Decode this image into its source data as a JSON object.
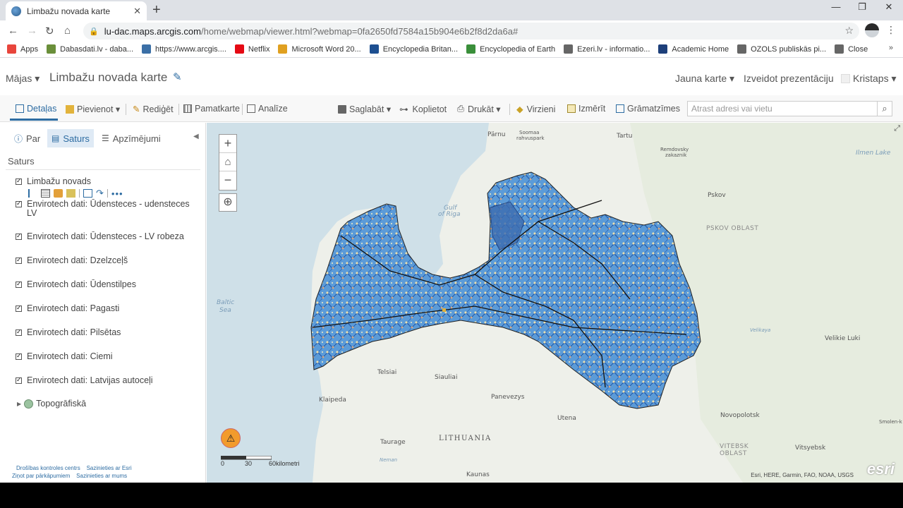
{
  "browser": {
    "tab_title": "Limbažu novada karte",
    "tab_close": "✕",
    "new_tab": "+",
    "win_min": "—",
    "win_max": "❐",
    "win_close": "✕",
    "url_host": "lu-dac.maps.arcgis.com",
    "url_path": "/home/webmap/viewer.html?webmap=0fa2650fd7584a15b904e6b2f8d2da6a#",
    "bookmarks": [
      {
        "label": "Apps",
        "color": "#e8453c"
      },
      {
        "label": "Dabasdati.lv - daba...",
        "color": "#6a8f3a"
      },
      {
        "label": "https://www.arcgis....",
        "color": "#3b6fa6"
      },
      {
        "label": "Netflix",
        "color": "#e50914"
      },
      {
        "label": "Microsoft Word 20...",
        "color": "#e0a020"
      },
      {
        "label": "Encyclopedia Britan...",
        "color": "#1d4f91"
      },
      {
        "label": "Encyclopedia of Earth",
        "color": "#3a8f3a"
      },
      {
        "label": "Ezeri.lv - informatio...",
        "color": "#666666"
      },
      {
        "label": "Academic Home",
        "color": "#1d3f7a"
      },
      {
        "label": "OZOLS publiskās pi...",
        "color": "#666666"
      },
      {
        "label": "Close",
        "color": "#666666"
      }
    ],
    "bookmarks_more": "»"
  },
  "header": {
    "home": "Mājas ▾",
    "title": "Limbažu novada karte",
    "new_map": "Jauna karte ▾",
    "create_presentation": "Izveidot prezentāciju",
    "user": "Kristaps ▾"
  },
  "toolbar": {
    "details": "Detaļas",
    "add": "Pievienot ▾",
    "edit": "Rediģēt",
    "basemap": "Pamatkarte",
    "analysis": "Analīze",
    "save": "Saglabāt ▾",
    "share": "Koplietot",
    "print": "Drukāt ▾",
    "directions": "Virzieni",
    "measure": "Izmērīt",
    "bookmarks": "Grāmatzīmes",
    "search_placeholder": "Atrast adresi vai vietu"
  },
  "panel": {
    "tab_about": "Par",
    "tab_content": "Saturs",
    "tab_legend": "Apzīmējumi",
    "heading": "Saturs",
    "layers": [
      "Limbažu novads",
      "Envirotech dati: Ūdensteces - udensteces LV",
      "Envirotech dati: Ūdensteces - LV robeza",
      "Envirotech dati: Dzelzceļš",
      "Envirotech dati: Ūdenstilpes",
      "Envirotech dati: Pagasti",
      "Envirotech dati: Pilsētas",
      "Envirotech dati: Ciemi",
      "Envirotech dati: Latvijas autoceļi"
    ],
    "basemap_layer": "Topogrāfiskā",
    "footer_1a": "Drošības kontroles centrs",
    "footer_1b": "Sazinieties ar Esri",
    "footer_2a": "Ziņot par pārkāpumiem",
    "footer_2b": "Sazinieties ar mums"
  },
  "map": {
    "scale_0": "0",
    "scale_30": "30",
    "scale_60": "60kilometri",
    "attribution": "Esri, HERE, Garmin, FAO, NOAA, USGS",
    "esri": "esri",
    "labels": {
      "parnu": "Pärnu",
      "soomaa": "Soomaa",
      "soomaa2": "rahvuspark",
      "tartu": "Tartu",
      "remdovsky": "Remdovsky",
      "zakaznik": "zakaznik",
      "ilmen": "Ilmen Lake",
      "pskov": "Pskov",
      "pskov_oblast": "PSKOV OBLAST",
      "gulf1": "Gulf",
      "gulf2": "of Riga",
      "baltic1": "Baltic",
      "baltic2": "Sea",
      "velikaya": "Velikaya",
      "velikie_luki": "Velikie Luki",
      "telsiai": "Telsiai",
      "siauliai": "Siauliai",
      "klaipeda": "Klaipeda",
      "panevezys": "Panevezys",
      "utena": "Utena",
      "taurage": "Taurage",
      "lithuania": "LITHUANIA",
      "novopolotsk": "Novopolotsk",
      "vitebsk1": "VITEBSK",
      "vitebsk2": "OBLAST",
      "vitsyebsk": "Vitsyebsk",
      "kaunas": "Kaunas",
      "neman": "Neman",
      "smolensk": "Smolen-k"
    }
  }
}
